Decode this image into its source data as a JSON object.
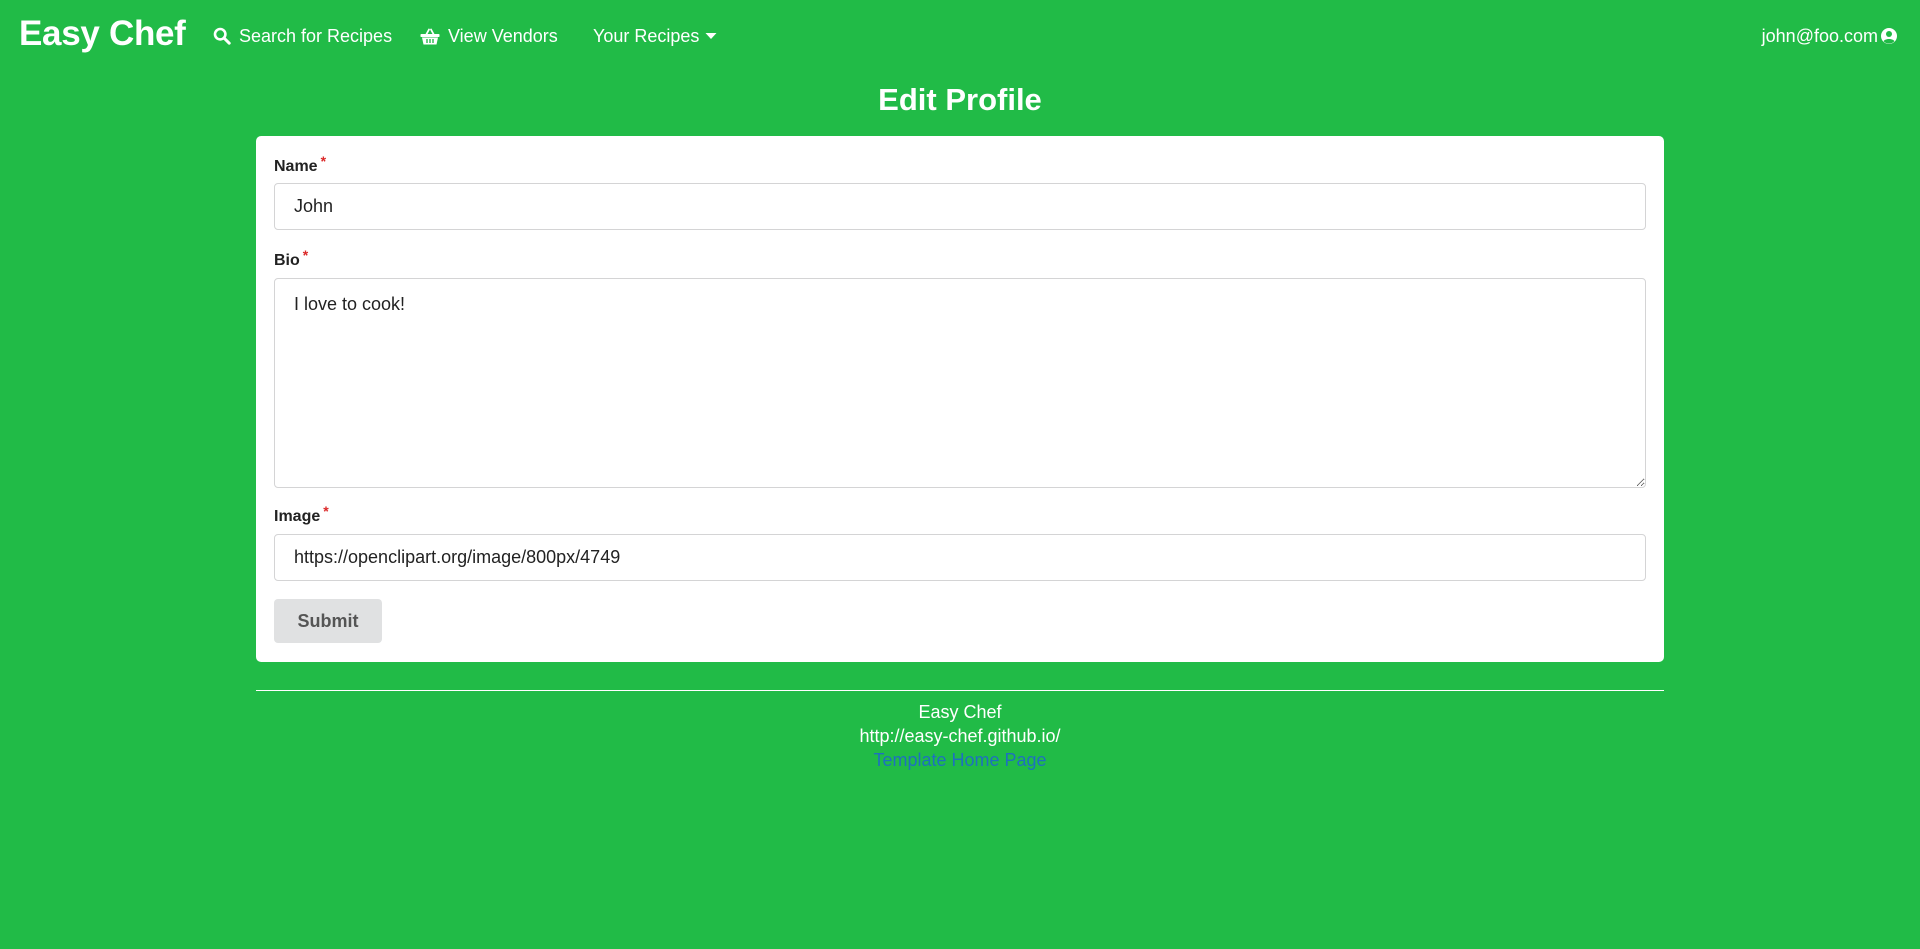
{
  "navbar": {
    "brand": "Easy Chef",
    "items": [
      {
        "label": "Search for Recipes",
        "icon": "search-icon"
      },
      {
        "label": "View Vendors",
        "icon": "basket-icon"
      },
      {
        "label": "Your Recipes",
        "icon": "caret-down-icon"
      }
    ],
    "user": {
      "email": "john@foo.com",
      "icon": "user-circle-icon"
    }
  },
  "page": {
    "title": "Edit Profile"
  },
  "form": {
    "required_marker": "*",
    "name": {
      "label": "Name",
      "value": "John"
    },
    "bio": {
      "label": "Bio",
      "value": "I love to cook!"
    },
    "image": {
      "label": "Image",
      "value": "https://openclipart.org/image/800px/4749"
    },
    "submit_label": "Submit"
  },
  "footer": {
    "title": "Easy Chef",
    "url": "http://easy-chef.github.io/",
    "link_label": "Template Home Page"
  },
  "colors": {
    "background": "#21bb47",
    "card": "#ffffff",
    "required": "#db2828",
    "button": "#e0e1e2",
    "link": "#1e70bf"
  }
}
